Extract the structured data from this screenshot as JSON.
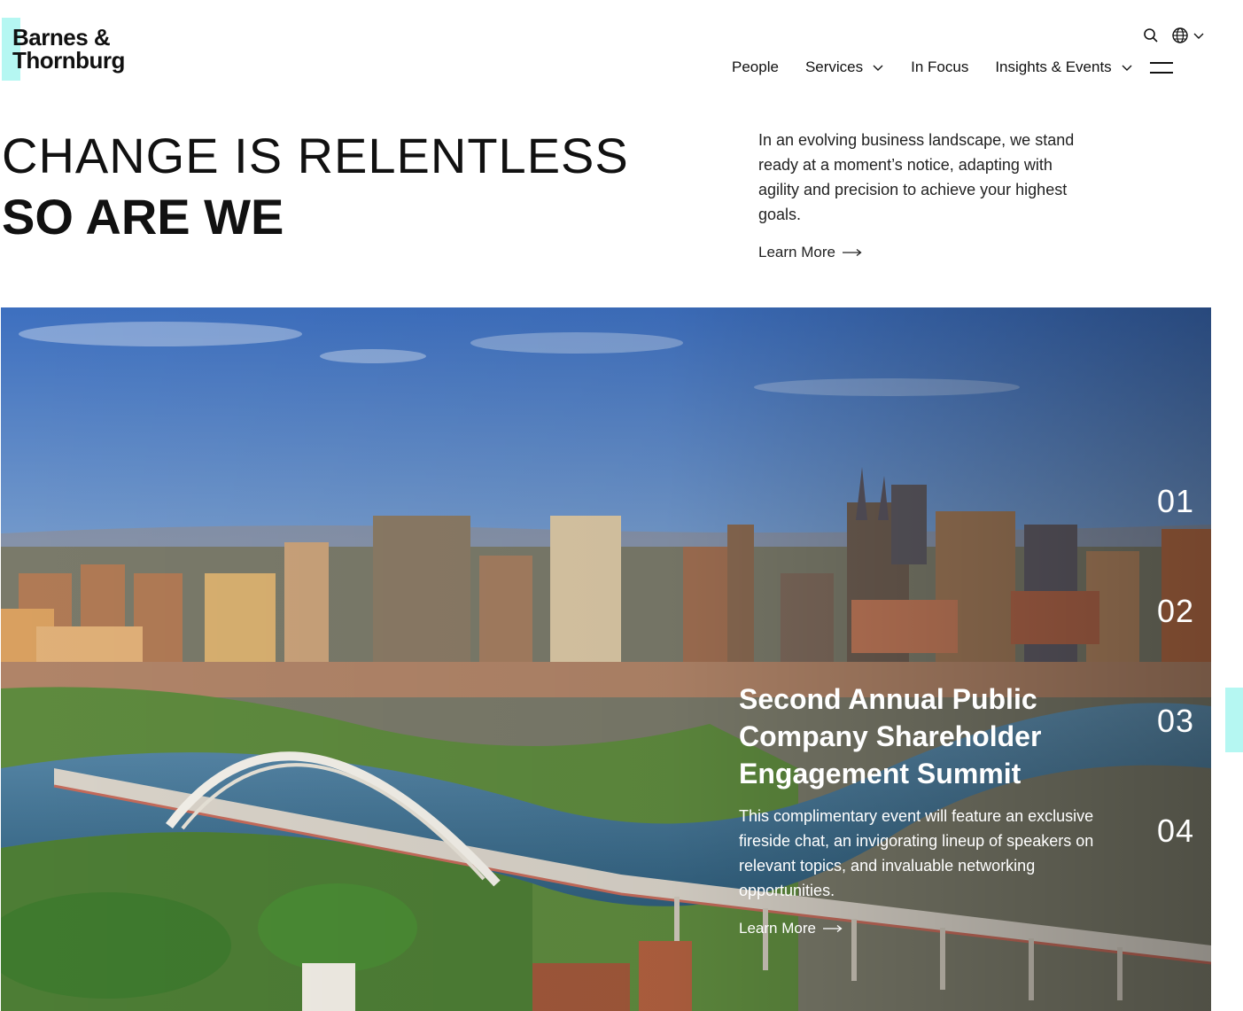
{
  "brand": {
    "logo_line1": "Barnes &",
    "logo_line2": "Thornburg",
    "accent_color": "#b5f7f2"
  },
  "utility": {
    "search_icon": "search-icon",
    "language_icon": "globe-icon"
  },
  "nav": {
    "items": [
      {
        "label": "People",
        "has_dropdown": false
      },
      {
        "label": "Services",
        "has_dropdown": true
      },
      {
        "label": "In Focus",
        "has_dropdown": false
      },
      {
        "label": "Insights & Events",
        "has_dropdown": true
      }
    ],
    "menu_icon": "hamburger-icon"
  },
  "hero": {
    "headline_line1": "CHANGE IS RELENTLESS",
    "headline_line2": "SO ARE WE",
    "intro": "In an evolving business landscape, we stand ready at a moment’s notice, adapting with agility and precision to achieve your highest goals.",
    "learn_more": "Learn More"
  },
  "slider": {
    "title": "Second Annual Public Company Shareholder Engagement Summit",
    "description": "This complimentary event will feature an exclusive fireside chat, an invigorating lineup of speakers on relevant topics, and invaluable networking opportunities.",
    "learn_more": "Learn More",
    "numbers": [
      "01",
      "02",
      "03",
      "04"
    ]
  }
}
